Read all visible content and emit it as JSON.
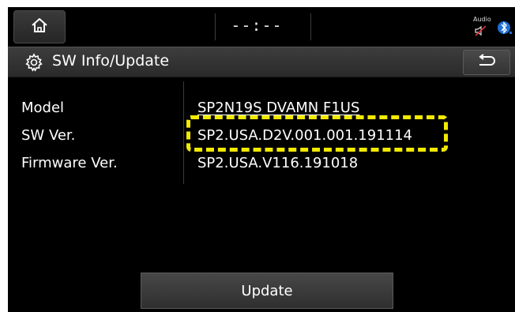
{
  "status_bar": {
    "clock": "--:--",
    "audio_label": "Audio",
    "icons": [
      "home-icon",
      "audio-mute-icon",
      "bluetooth-icon"
    ]
  },
  "title_bar": {
    "title": "SW Info/Update",
    "icons": [
      "gear-icon",
      "back-icon"
    ]
  },
  "info": {
    "rows": [
      {
        "label": "Model",
        "value": "SP2N19S DVAMN F1US"
      },
      {
        "label": "SW Ver.",
        "value": "SP2.USA.D2V.001.001.191114"
      },
      {
        "label": "Firmware Ver.",
        "value": "SP2.USA.V116.191018"
      }
    ]
  },
  "actions": {
    "update_label": "Update"
  },
  "colors": {
    "highlight": "#f2ea00",
    "background": "#000000"
  }
}
